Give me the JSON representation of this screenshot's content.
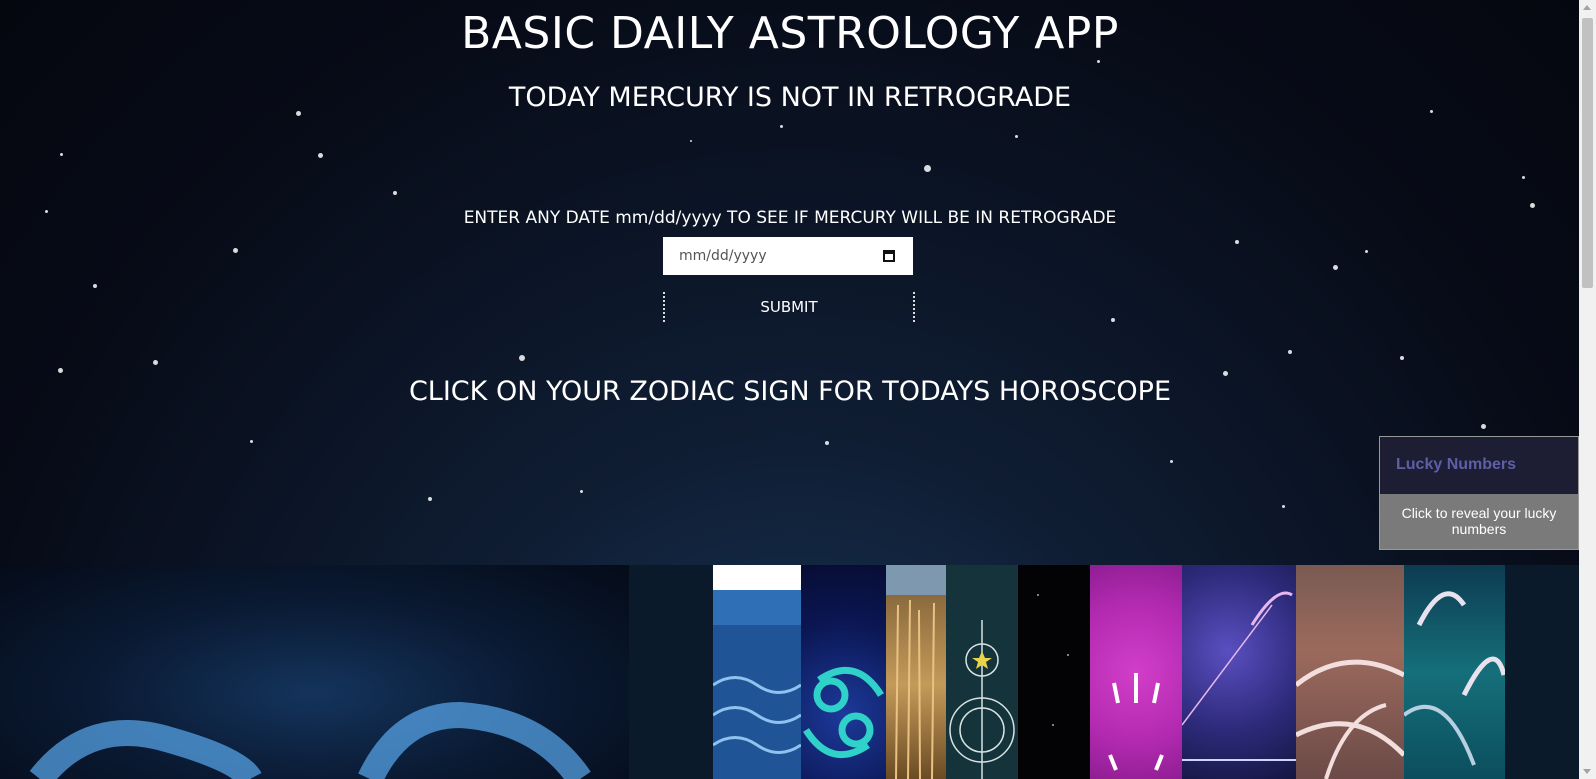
{
  "header": {
    "title": "BASIC DAILY ASTROLOGY APP",
    "mercury_status": "TODAY MERCURY IS NOT IN RETROGRADE"
  },
  "date_form": {
    "prompt": "ENTER ANY DATE mm/dd/yyyy TO SEE IF MERCURY WILL BE IN RETROGRADE",
    "placeholder": "mm/dd/yyyy",
    "submit_label": "SUBMIT"
  },
  "zodiac_heading": "CLICK ON YOUR ZODIAC SIGN FOR TODAYS HOROSCOPE",
  "lucky_numbers": {
    "title": "Lucky Numbers",
    "action_text": "Click to reveal your lucky numbers"
  },
  "zodiac_tiles": [
    {
      "icon": "aries-icon"
    },
    {
      "icon": "aquarius-icon"
    },
    {
      "icon": "cancer-icon"
    },
    {
      "icon": "wheat-icon"
    },
    {
      "icon": "virgo-icon"
    },
    {
      "icon": "dark-sky-icon"
    },
    {
      "icon": "glitter-icon"
    },
    {
      "icon": "sagittarius-icon"
    },
    {
      "icon": "nebula-icon"
    },
    {
      "icon": "wave-icon"
    }
  ]
}
